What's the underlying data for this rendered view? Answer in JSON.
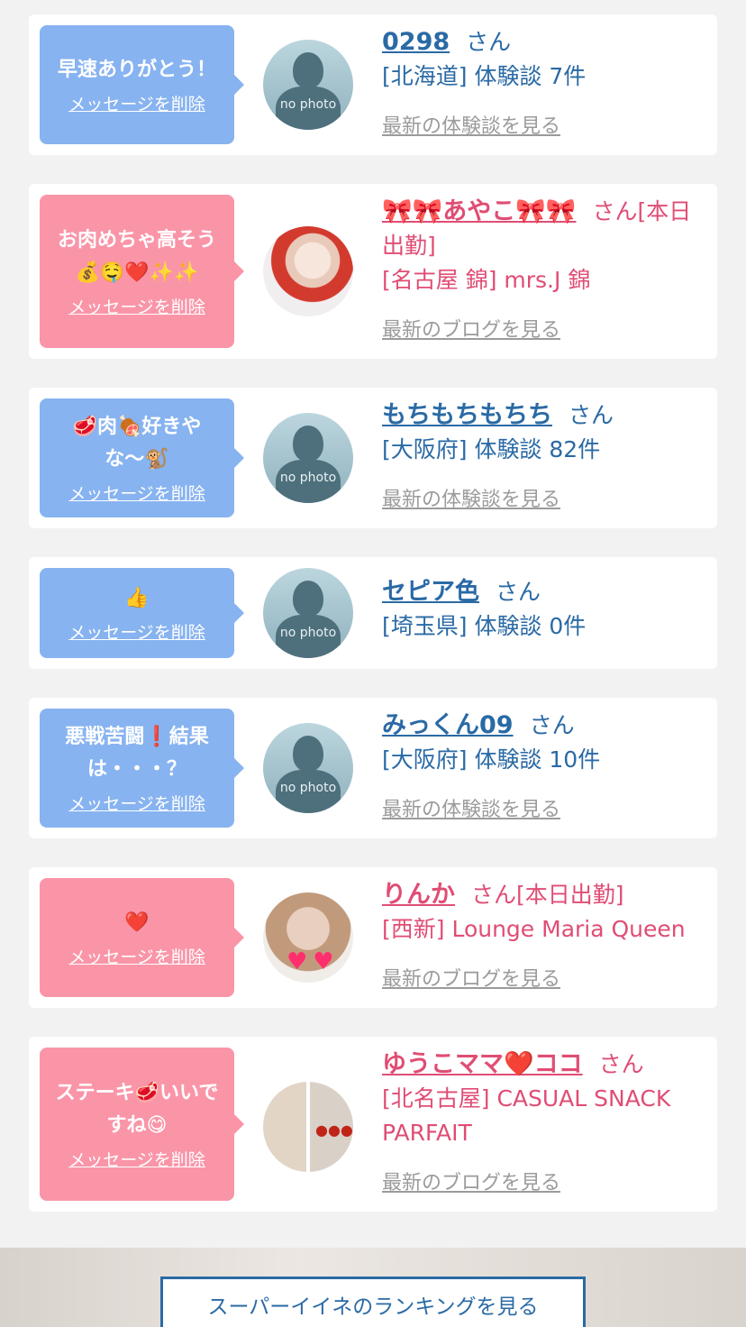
{
  "delete_label": "メッセージを削除",
  "san_label": "さん",
  "nophoto_label": "no photo",
  "cards": [
    {
      "message": "早速ありがとう！",
      "name": "0298",
      "suffix": "",
      "sub": "[北海道] 体験談 7件",
      "link": "最新の体験談を見る"
    },
    {
      "message": "お肉めちゃ高そう\n💰🤤❤️✨✨",
      "name": "🎀🎀あやこ🎀🎀",
      "suffix": "[本日",
      "suffix2": "出勤]",
      "sub": "[名古屋 錦] mrs.J 錦",
      "link": "最新のブログを見る"
    },
    {
      "message": "🥩肉🍖好きや\nな〜🐒",
      "name": "もちもちもちち",
      "suffix": "",
      "sub": "[大阪府] 体験談 82件",
      "link": "最新の体験談を見る"
    },
    {
      "message": "👍",
      "name": "セピア色",
      "suffix": "",
      "sub": "[埼玉県] 体験談 0件",
      "link": ""
    },
    {
      "message": "悪戦苦闘❗結果\nは・・・？",
      "name": "みっくん09",
      "suffix": "",
      "sub": "[大阪府] 体験談 10件",
      "link": "最新の体験談を見る"
    },
    {
      "message": "❤️",
      "name": "りんか",
      "suffix": "[本日出勤]",
      "sub": "[西新] Lounge Maria Queen",
      "link": "最新のブログを見る"
    },
    {
      "message": "ステーキ🥩いいで\nすね😋",
      "name": "ゆうこママ❤️ココ",
      "suffix": "",
      "sub": "[北名古屋] CASUAL SNACK",
      "sub2": "PARFAIT",
      "link": "最新のブログを見る"
    }
  ],
  "ranking_button": "スーパーイイネのランキングを見る",
  "colors": {
    "bubble_blue": "#87b3f0",
    "bubble_pink": "#fa95a8",
    "name_blue": "#2a6aa5",
    "name_pink": "#e04d74"
  }
}
